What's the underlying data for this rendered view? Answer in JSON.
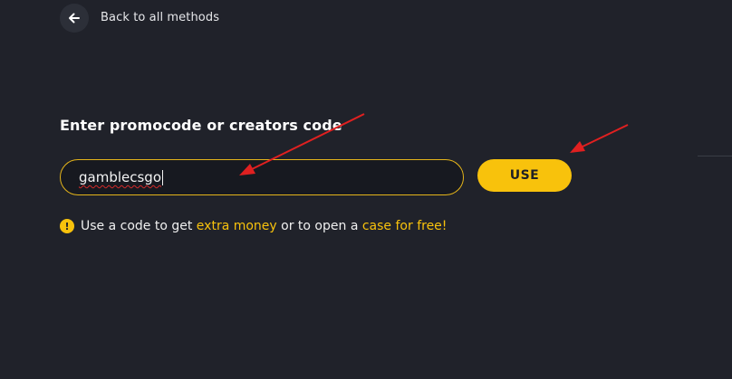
{
  "nav": {
    "back_label": "Back to all methods",
    "back_icon": "arrow-left-icon"
  },
  "promo": {
    "title": "Enter promocode or creators code",
    "input_value": "gamblecsgo",
    "button_label": "USE"
  },
  "hint": {
    "icon": "exclamation-circle-icon",
    "text_before": "Use a code to get",
    "highlight_1": "extra money",
    "text_middle": "or to open a",
    "highlight_2": "case for free!"
  },
  "colors": {
    "background": "#20222a",
    "accent": "#f8c20c",
    "input_border": "#e5b51a",
    "annotation_arrow": "#e02020"
  }
}
